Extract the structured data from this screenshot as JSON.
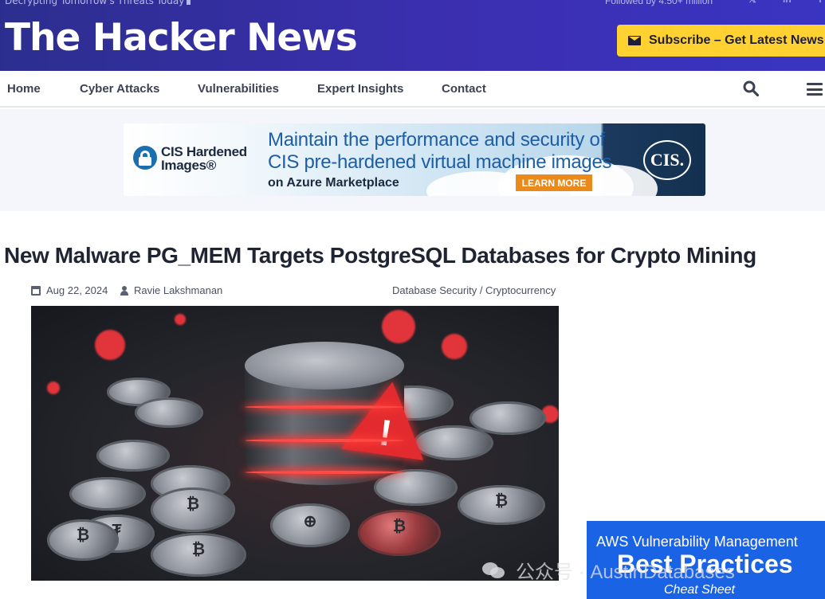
{
  "topbar": {
    "tagline": "Decrypting Tomorrow's Threats Today",
    "followers": "Followed by 4.50+ million",
    "social": [
      "twitter-icon",
      "linkedin-icon",
      "facebook-icon"
    ]
  },
  "header": {
    "logo": "The Hacker News",
    "subscribe_label": "Subscribe – Get Latest News"
  },
  "nav": {
    "items": [
      "Home",
      "Cyber Attacks",
      "Vulnerabilities",
      "Expert Insights",
      "Contact"
    ]
  },
  "ad": {
    "brand": "CIS Hardened Images®",
    "line1": "Maintain the performance and security of",
    "line2": "CIS pre-hardened virtual machine images",
    "line3": "on Azure Marketplace",
    "button": "LEARN MORE",
    "logo": "CIS."
  },
  "article": {
    "title": "New Malware PG_MEM Targets PostgreSQL Databases for Crypto Mining",
    "date": "Aug 22, 2024",
    "author": "Ravie Lakshmanan",
    "tags": "Database Security / Cryptocurrency"
  },
  "promo": {
    "line1": "AWS Vulnerability Management",
    "line2": "Best Practices",
    "line3": "Cheat Sheet"
  },
  "watermark": "公众号 · AustinDatabases",
  "colors": {
    "header_bg": "#3b2fb0",
    "subscribe_bg": "#ffd232",
    "promo_bg": "#1a63e4",
    "nav_text": "#3b4254"
  }
}
